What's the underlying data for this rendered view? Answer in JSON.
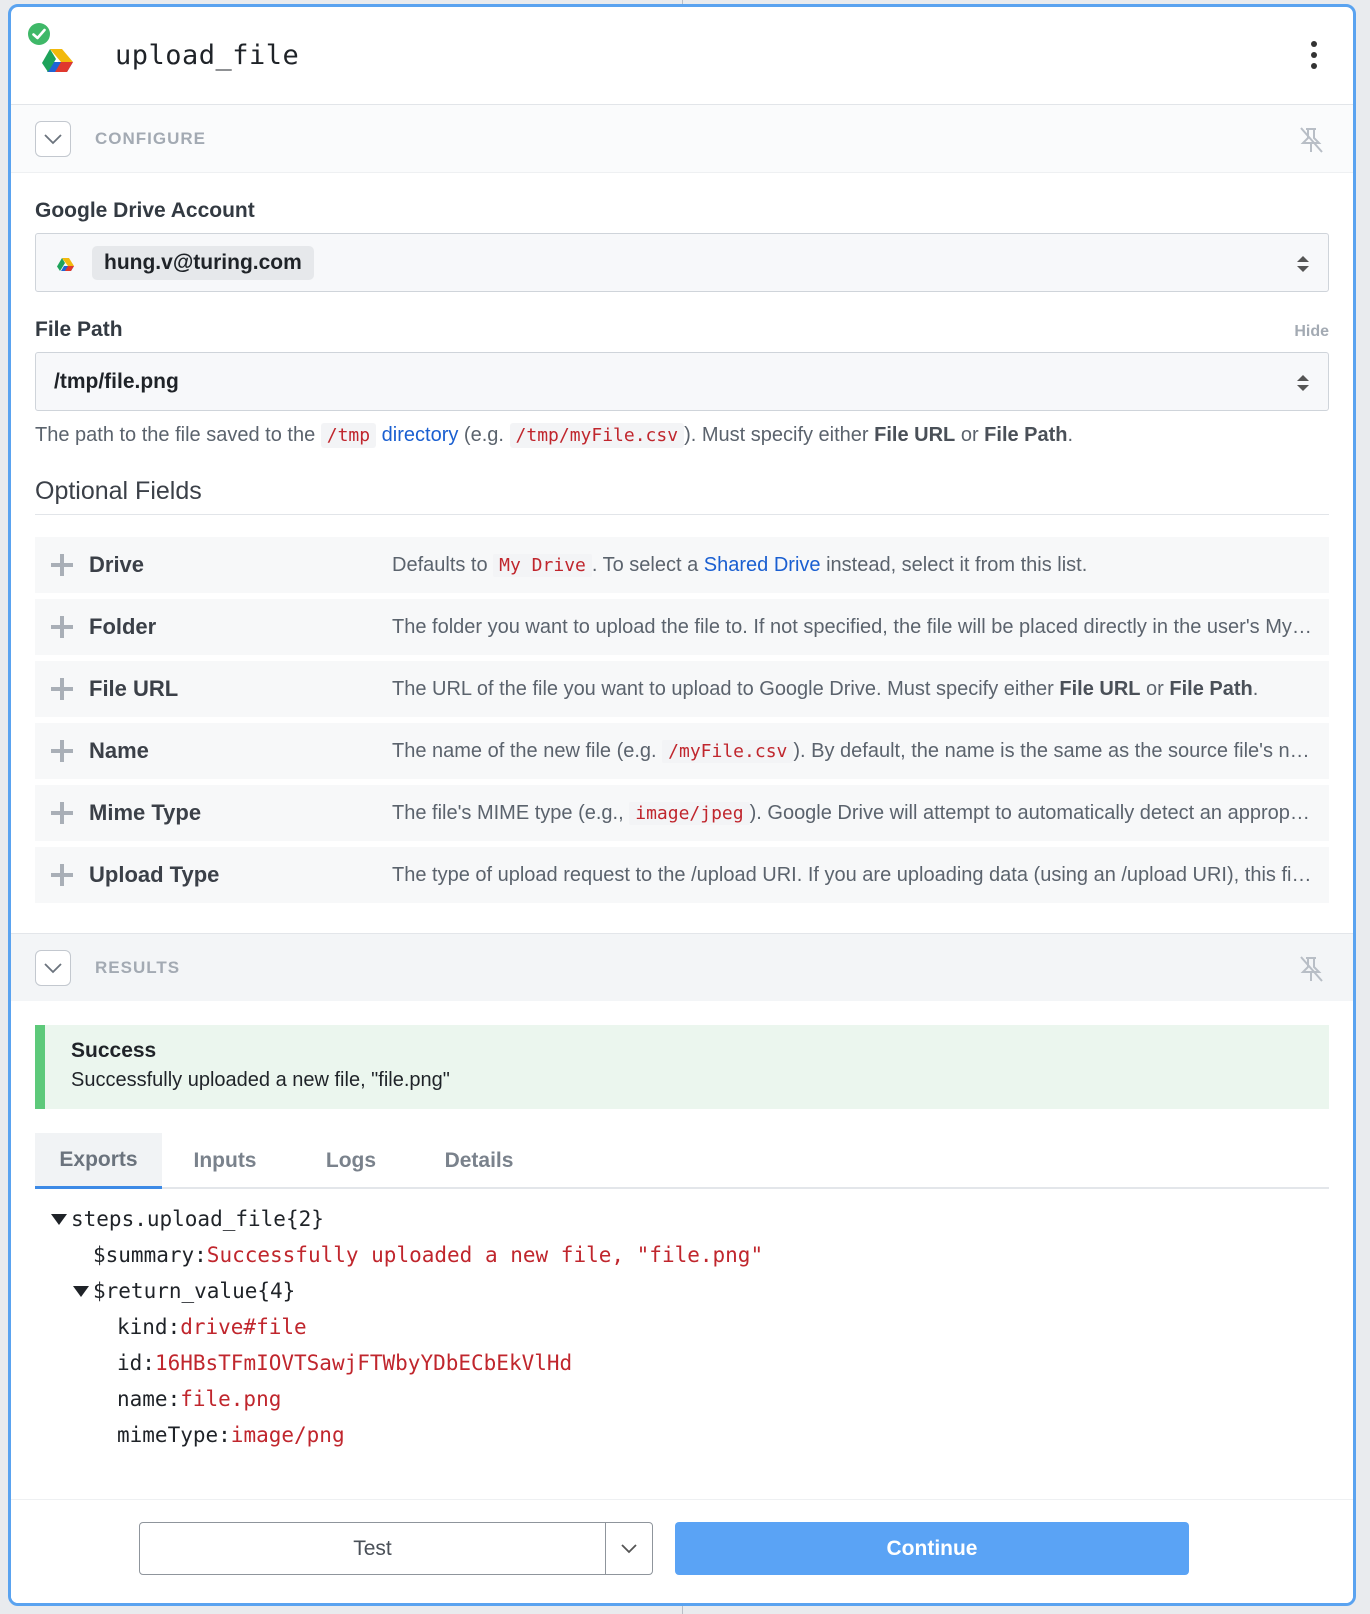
{
  "header": {
    "title": "upload_file",
    "app_icon": "google-drive-icon",
    "status_icon": "check-circle-icon",
    "menu_icon": "kebab-menu-icon"
  },
  "configure": {
    "label": "CONFIGURE",
    "account": {
      "label": "Google Drive Account",
      "value": "hung.v@turing.com"
    },
    "file_path": {
      "label": "File Path",
      "hide_label": "Hide",
      "value": "/tmp/file.png",
      "help": {
        "t1": "The path to the file saved to the ",
        "code1": "/tmp",
        "link": "directory",
        "t2": " (e.g. ",
        "code2": "/tmp/myFile.csv",
        "t3": "). Must specify either ",
        "b1": "File URL",
        "t4": " or ",
        "b2": "File Path",
        "t5": "."
      }
    },
    "optional_title": "Optional Fields",
    "optional": {
      "drive": {
        "name": "Drive",
        "t1": "Defaults to ",
        "code": "My Drive",
        "t2": ". To select a ",
        "link": "Shared Drive",
        "t3": " instead, select it from this list."
      },
      "folder": {
        "name": "Folder",
        "t1": "The folder you want to upload the file to. If not specified, the file will be placed directly in the user's My Drive folder."
      },
      "file_url": {
        "name": "File URL",
        "t1": "The URL of the file you want to upload to Google Drive. Must specify either ",
        "b1": "File URL",
        "t2": " or ",
        "b2": "File Path",
        "t3": "."
      },
      "name": {
        "name": "Name",
        "t1": "The name of the new file (e.g. ",
        "code": "/myFile.csv",
        "t2": "). By default, the name is the same as the source file's name."
      },
      "mime_type": {
        "name": "Mime Type",
        "t1": "The file's MIME type (e.g., ",
        "code": "image/jpeg",
        "t2": "). Google Drive will attempt to automatically detect an appropriate value."
      },
      "upload_type": {
        "name": "Upload Type",
        "t1": "The type of upload request to the /upload URI. If you are uploading data (using an /upload URI), this field is required."
      }
    }
  },
  "results": {
    "label": "RESULTS",
    "success_title": "Success",
    "success_message": "Successfully uploaded a new file, \"file.png\"",
    "tabs": [
      "Exports",
      "Inputs",
      "Logs",
      "Details"
    ],
    "active_tab": "Exports",
    "tree": {
      "root_key": "steps.upload_file",
      "root_count": "{2}",
      "summary_key": "$summary:",
      "summary_value": "Successfully uploaded a new file, \"file.png\"",
      "return_key": "$return_value",
      "return_count": "{4}",
      "kind_key": "kind:",
      "kind_value": "drive#file",
      "id_key": "id:",
      "id_value": "16HBsTFmIOVTSawjFTWbyYDbECbEkVlHd",
      "name_key": "name:",
      "name_value": "file.png",
      "mime_key": "mimeType:",
      "mime_value": "image/png"
    }
  },
  "footer": {
    "test_label": "Test",
    "continue_label": "Continue"
  },
  "colors": {
    "accent": "#5aa3f0",
    "success": "#5dc97a",
    "code_red": "#c0262d",
    "link_blue": "#1a5fd1"
  }
}
